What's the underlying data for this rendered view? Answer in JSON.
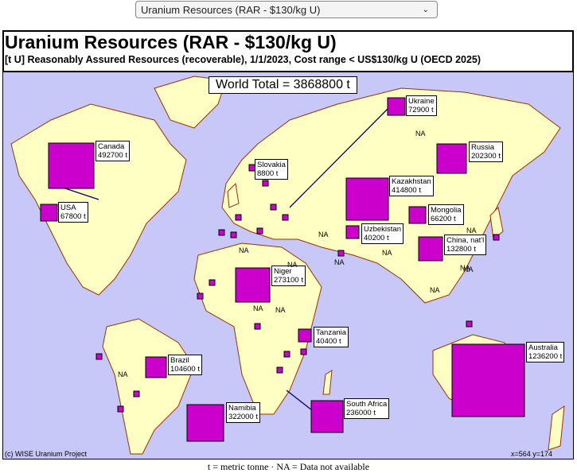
{
  "selector": {
    "value": "Uranium Resources (RAR - $130/kg U)"
  },
  "title": "Uranium Resources (RAR - $130/kg U)",
  "subtitle": "[t U] Reasonably Assured Resources (recoverable), 1/1/2023, Cost range < US$130/kg U  (OECD 2025)",
  "world_total": "World Total = 3868800 t",
  "copyright": "(c) WISE Uranium Project",
  "coords": "x=564  y=174",
  "footer": "t = metric tonne   ·   NA = Data not available",
  "colors": {
    "ocean": "#c8c8f8",
    "land": "#ffffc4",
    "border": "#993300",
    "marker": "#cc00cc"
  },
  "na_label": "NA",
  "countries": [
    {
      "name": "Canada",
      "value": "492700 t",
      "tonnes": 492700
    },
    {
      "name": "USA",
      "value": "67800 t",
      "tonnes": 67800
    },
    {
      "name": "Slovakia",
      "value": "8800 t",
      "tonnes": 8800
    },
    {
      "name": "Ukraine",
      "value": "72900 t",
      "tonnes": 72900
    },
    {
      "name": "Kazakhstan",
      "value": "414800 t",
      "tonnes": 414800
    },
    {
      "name": "Russia",
      "value": "202300 t",
      "tonnes": 202300
    },
    {
      "name": "Mongolia",
      "value": "66200 t",
      "tonnes": 66200
    },
    {
      "name": "Uzbekistan",
      "value": "40200 t",
      "tonnes": 40200
    },
    {
      "name": "China, nat'l",
      "value": "132800 t",
      "tonnes": 132800
    },
    {
      "name": "Niger",
      "value": "273100 t",
      "tonnes": 273100
    },
    {
      "name": "Tanzania",
      "value": "40400 t",
      "tonnes": 40400
    },
    {
      "name": "Brazil",
      "value": "104600 t",
      "tonnes": 104600
    },
    {
      "name": "Australia",
      "value": "1236200 t",
      "tonnes": 1236200
    },
    {
      "name": "Namibia",
      "value": "322000 t",
      "tonnes": 322000
    },
    {
      "name": "South Africa",
      "value": "236000 t",
      "tonnes": 236000
    }
  ]
}
